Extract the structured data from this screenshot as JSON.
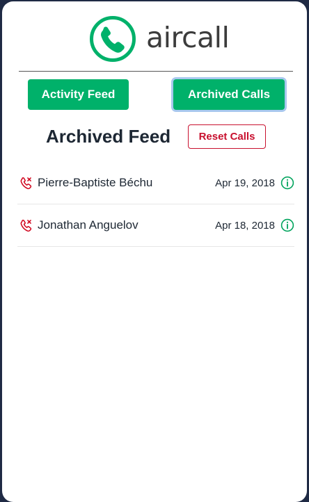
{
  "brand": {
    "name": "aircall",
    "logo_icon": "phone-handset-in-circle",
    "accent_color": "#00b16a"
  },
  "nav": {
    "activity_label": "Activity Feed",
    "archived_label": "Archived Calls",
    "active_tab": "Archived Calls"
  },
  "feed": {
    "title": "Archived Feed",
    "reset_label": "Reset Calls"
  },
  "calls": [
    {
      "caller": "Pierre-Baptiste Béchu",
      "date": "Apr 19, 2018",
      "type": "missed",
      "status_icon": "missed-call-icon",
      "details_icon": "info-icon"
    },
    {
      "caller": "Jonathan Anguelov",
      "date": "Apr 18, 2018",
      "type": "missed",
      "status_icon": "missed-call-icon",
      "details_icon": "info-icon"
    }
  ],
  "colors": {
    "missed": "#d0021b",
    "primary": "#00b16a",
    "danger": "#c8102e",
    "page_background": "#1f2a44"
  }
}
